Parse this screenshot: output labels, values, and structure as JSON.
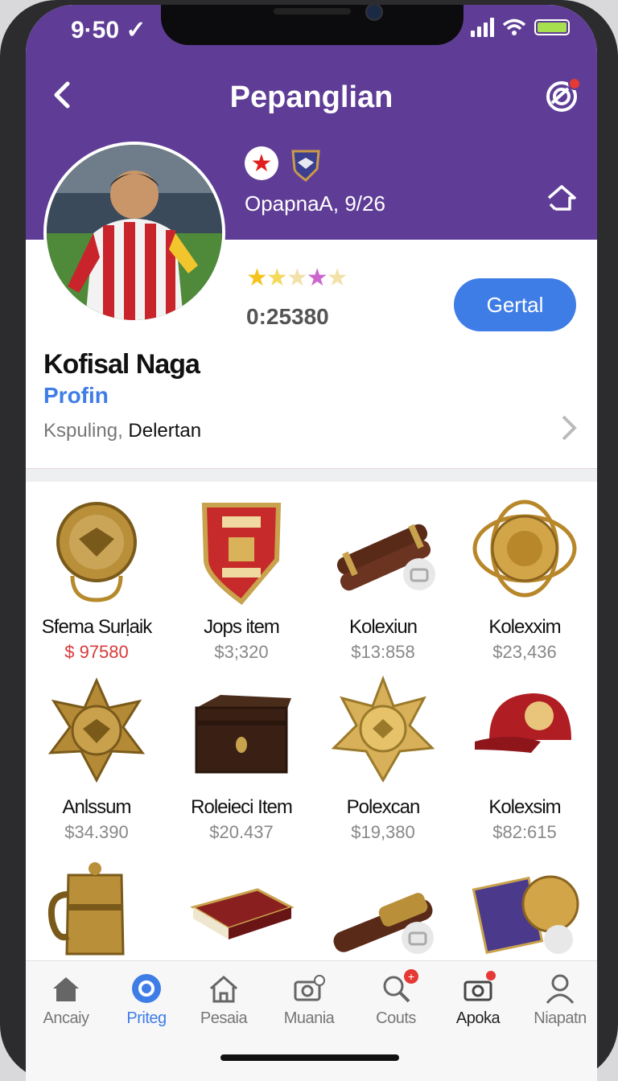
{
  "status_bar": {
    "time": "9·50 ✓"
  },
  "header": {
    "title": "Pepanglian",
    "player_meta": "OpapnaA, 9/26"
  },
  "profile": {
    "name": "Kofisal Naga",
    "link": "Profin",
    "location_prefix": "Kspuling,",
    "location_value": "Delertan",
    "score": "0:25380",
    "cta_label": "Gertal",
    "rating_stars": 5,
    "star_colors": [
      "#f4c31c",
      "#f4d95a",
      "#f2e1a8",
      "#cc66cc",
      "#f2e1a8"
    ]
  },
  "items": [
    {
      "label": "Sfema Surḷaik",
      "price": "$ 97580",
      "icon": "medal-icon",
      "price_color": "red"
    },
    {
      "label": "Jops item",
      "price": "$3;320",
      "icon": "crest-shield-icon"
    },
    {
      "label": "Kolexiun",
      "price": "$13:858",
      "icon": "scroll-icon"
    },
    {
      "label": "Kolexxim",
      "price": "$23,436",
      "icon": "gold-ornament-icon"
    },
    {
      "label": "Anlssum",
      "price": "$34.390",
      "icon": "star-medal-icon"
    },
    {
      "label": "Roleieci Item",
      "price": "$20.437",
      "icon": "wooden-chest-icon"
    },
    {
      "label": "Polexcan",
      "price": "$19,380",
      "icon": "gold-star-icon"
    },
    {
      "label": "Kolexsim",
      "price": "$82:615",
      "icon": "red-cap-icon"
    },
    {
      "label": "",
      "price": "",
      "icon": "gold-mug-icon"
    },
    {
      "label": "",
      "price": "",
      "icon": "book-icon"
    },
    {
      "label": "",
      "price": "",
      "icon": "telescope-icon"
    },
    {
      "label": "",
      "price": "",
      "icon": "badge-coin-icon"
    }
  ],
  "tabs": [
    {
      "label": "Ancaiy",
      "icon": "home-icon"
    },
    {
      "label": "Priteg",
      "icon": "gear-icon",
      "active": true
    },
    {
      "label": "Pesaia",
      "icon": "house-outline-icon"
    },
    {
      "label": "Muania",
      "icon": "camera-icon"
    },
    {
      "label": "Couts",
      "icon": "search-icon",
      "badge": "+"
    },
    {
      "label": "Apoka",
      "icon": "camera-alt-icon"
    },
    {
      "label": "Niapatn",
      "icon": "user-icon"
    }
  ],
  "colors": {
    "header": "#5f3d96",
    "accent": "#3f7de6",
    "price_red": "#d83a3a"
  }
}
